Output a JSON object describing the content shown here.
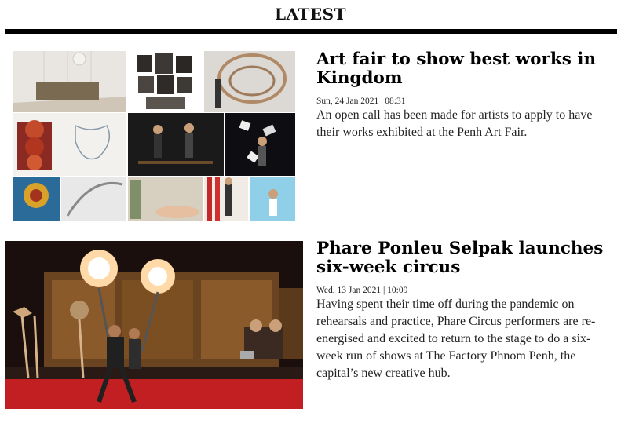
{
  "section": {
    "title": "LATEST"
  },
  "articles": [
    {
      "headline": "Art fair to show best works in Kingdom",
      "date": "Sun, 24 Jan 2021 | 08:31",
      "summary": "An open call has been made for artists to apply to have their works exhibited at the Penh Art Fair."
    },
    {
      "headline": "Phare Ponleu Selpak launches six-week circus",
      "date": "Wed, 13 Jan 2021 | 10:09",
      "summary": "Having spent their time off during the pandemic on rehearsals and practice, Phare Circus performers are re-energised and excited to return to the stage to do a six-week run of shows at The Factory Phnom Penh, the capital’s new creative hub."
    }
  ]
}
